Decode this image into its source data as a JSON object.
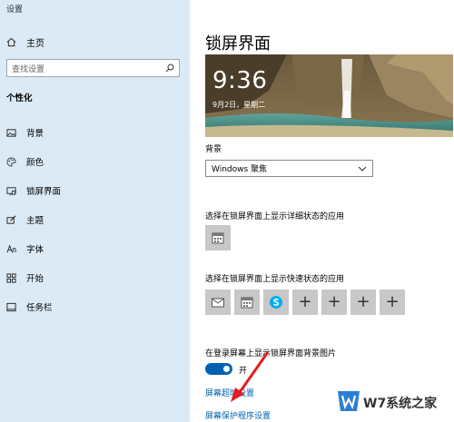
{
  "app": {
    "title": "设置"
  },
  "sidebar": {
    "home_label": "主页",
    "search_placeholder": "查找设置",
    "section_title": "个性化",
    "items": [
      {
        "label": "背景",
        "icon": "image-icon"
      },
      {
        "label": "颜色",
        "icon": "palette-icon"
      },
      {
        "label": "锁屏界面",
        "icon": "lock-screen-icon"
      },
      {
        "label": "主题",
        "icon": "brush-icon"
      },
      {
        "label": "字体",
        "icon": "font-icon"
      },
      {
        "label": "开始",
        "icon": "start-grid-icon"
      },
      {
        "label": "任务栏",
        "icon": "taskbar-icon"
      }
    ]
  },
  "main": {
    "title": "锁屏界面",
    "preview": {
      "time": "9:36",
      "date": "9月2日，星期二"
    },
    "background_label": "背景",
    "background_value": "Windows 聚焦",
    "detail_label": "选择在锁屏界面上显示详细状态的应用",
    "quick_label": "选择在锁屏界面上显示快速状态的应用",
    "quick_apps": [
      "mail-icon",
      "calendar-icon",
      "skype-icon",
      "plus-icon",
      "plus-icon",
      "plus-icon",
      "plus-icon"
    ],
    "plus_glyph": "+",
    "login_label": "在登录屏幕上显示锁屏界面背景图片",
    "toggle_state": "开",
    "link_timeout": "屏幕超时设置",
    "link_screensaver": "屏幕保护程序设置"
  },
  "watermark": {
    "text": "W7系统之家"
  },
  "colors": {
    "accent": "#0063b1",
    "sidebar_bg": "#dbeaf5",
    "arrow": "#e02020"
  }
}
